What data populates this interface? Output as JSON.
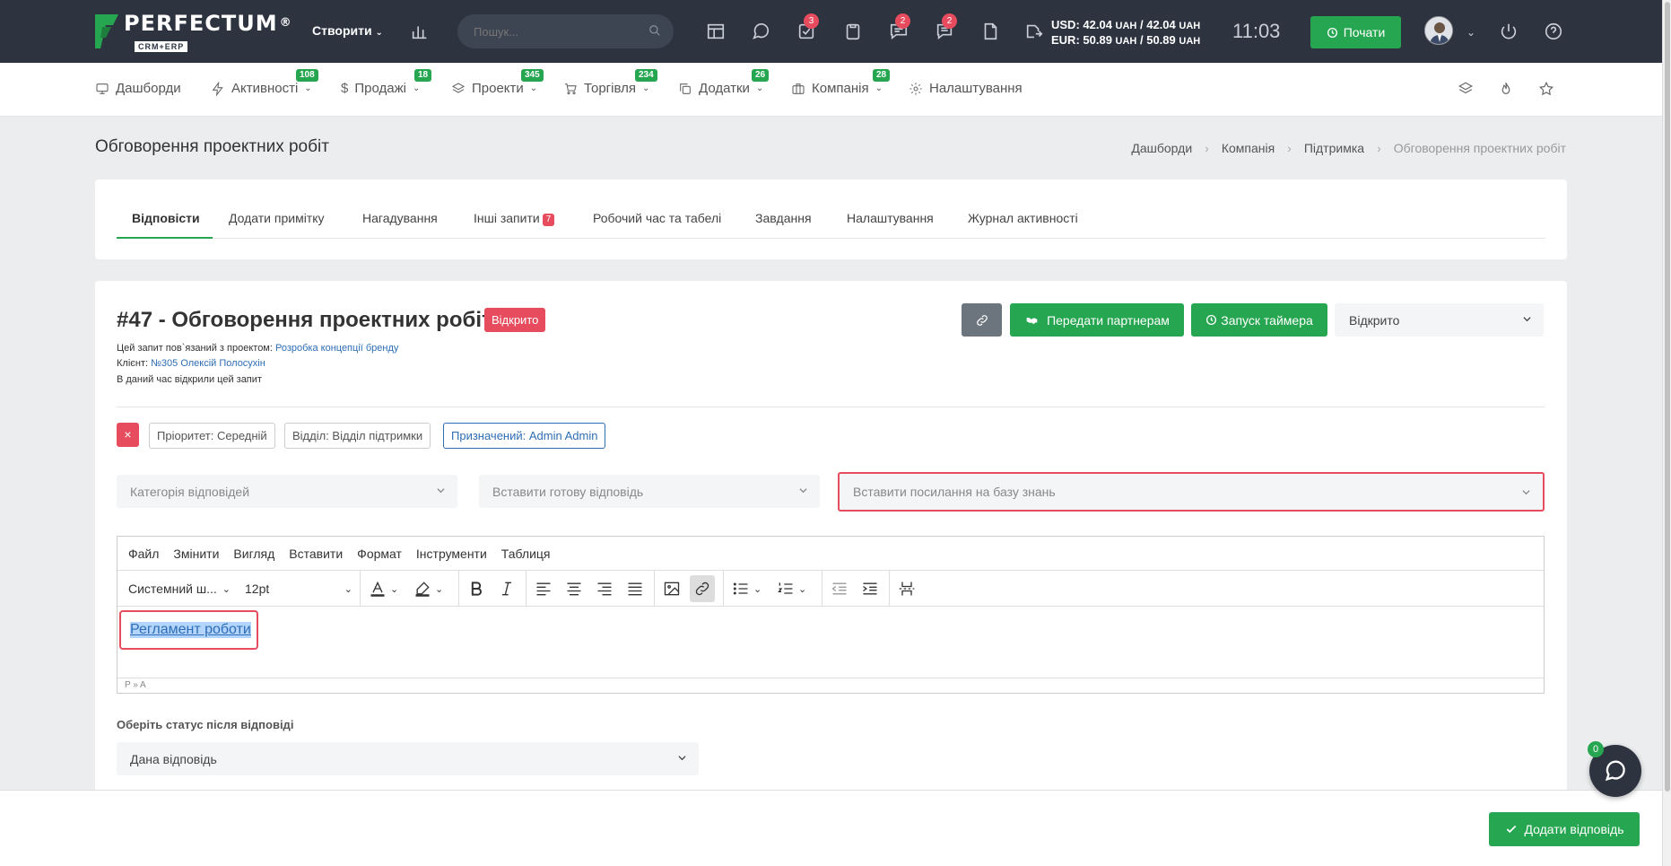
{
  "topbar": {
    "logo_text": "PERFECTUM",
    "logo_reg": "®",
    "logo_sub": "CRM+ERP",
    "create_label": "Створити",
    "search_placeholder": "Пошук...",
    "badges": {
      "tasks": "3",
      "chat": "2",
      "messages": "2"
    },
    "currency": {
      "usd": "USD: 42.04 ",
      "usd_mid": " / 42.04 ",
      "eur": "EUR: 50.89 ",
      "eur_mid": " / 50.89 ",
      "unit": "UAH"
    },
    "time": "11:03",
    "start_label": "Почати"
  },
  "navbar": {
    "items": [
      {
        "label": "Дашборди",
        "badge": ""
      },
      {
        "label": "Активності",
        "badge": "108"
      },
      {
        "label": "Продажі",
        "badge": "18"
      },
      {
        "label": "Проекти",
        "badge": "345"
      },
      {
        "label": "Торгівля",
        "badge": "234"
      },
      {
        "label": "Додатки",
        "badge": "26"
      },
      {
        "label": "Компанія",
        "badge": "28"
      },
      {
        "label": "Налаштування",
        "badge": ""
      }
    ]
  },
  "page": {
    "title": "Обговорення проектних робіт",
    "breadcrumb": [
      "Дашборди",
      "Компанія",
      "Підтримка",
      "Обговорення проектних робіт"
    ]
  },
  "tabs": [
    {
      "label": "Відповісти"
    },
    {
      "label": "Додати примітку"
    },
    {
      "label": "Нагадування"
    },
    {
      "label": "Інші запити",
      "badge": "7"
    },
    {
      "label": "Робочий час та табелі"
    },
    {
      "label": "Завдання"
    },
    {
      "label": "Налаштування"
    },
    {
      "label": "Журнал активності"
    }
  ],
  "ticket": {
    "title": "#47 - Обговорення проектних робіт",
    "status_badge": "Відкрито",
    "project_prefix": "Цей запит пов`язаний з проектом: ",
    "project_link": "Розробка концепції бренду",
    "client_prefix": "Клієнт: ",
    "client_link": "№305 Олексій Полосухін",
    "viewing_note": "В даний час відкрили цей запит",
    "btn_partners": "Передати партнерам",
    "btn_timer": "Запуск таймера",
    "status_select": "Відкрито",
    "tag_remove": "×",
    "tag_priority": "Пріоритет: Середній",
    "tag_department": "Відділ: Відділ підтримки",
    "tag_assigned": "Призначений: Admin Admin",
    "sel_category": "Категорія відповідей",
    "sel_ready": "Вставити готову відповідь",
    "sel_kb": "Вставити посилання на базу знань"
  },
  "editor": {
    "menu": [
      "Файл",
      "Змінити",
      "Вигляд",
      "Вставити",
      "Формат",
      "Інструменти",
      "Таблиця"
    ],
    "font_family": "Системний ш...",
    "font_size": "12pt",
    "content_link": "Регламент роботи",
    "status_path": "P » A"
  },
  "after": {
    "label": "Оберіть статус після відповіді",
    "value": "Дана відповідь"
  },
  "footer": {
    "add_reply": "Додати відповідь"
  },
  "chat": {
    "badge": "0"
  },
  "colors": {
    "topbar": "#2d3440",
    "accent_green": "#26a650",
    "danger": "#e74c5e",
    "link": "#2d6db5"
  }
}
